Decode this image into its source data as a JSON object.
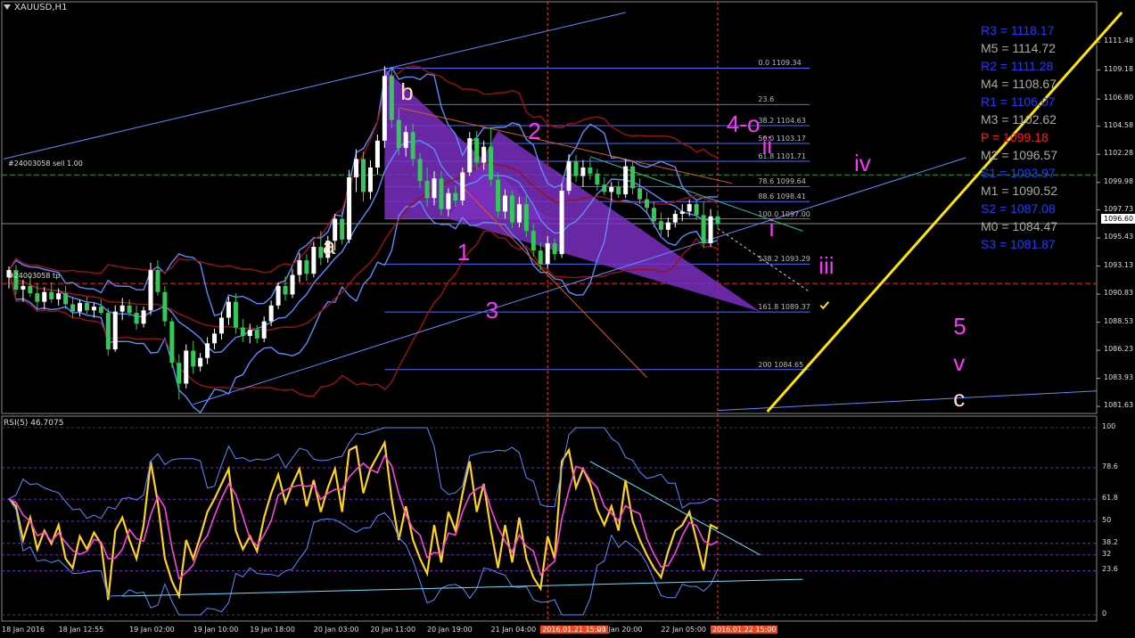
{
  "header": {
    "symbol": "XAUUSD,H1",
    "rsi_title": "RSI(5) 46.7075"
  },
  "colors": {
    "bg": "#000000",
    "bull": "#ffffff",
    "bear": "#34c759",
    "band_blue": "#5b8cff",
    "band_red": "#a01010",
    "pattern": "#7b2fbf",
    "yellow": "#ffe600",
    "magenta": "#ff33ff",
    "pivot_blue": "#1e3cff",
    "pivot_gray": "#aaaaaa",
    "pivot_red": "#ff1a1a"
  },
  "orders": {
    "sell_label": "#24003058 sell 1.00",
    "tp_label": "#24003058 tp",
    "current_price": "1096.60"
  },
  "pivots": [
    {
      "label": "R3 = 1118.17",
      "color": "#1e3cff"
    },
    {
      "label": "M5 = 1114.72",
      "color": "#aaaaaa"
    },
    {
      "label": "R2 = 1111.28",
      "color": "#1e3cff"
    },
    {
      "label": "M4 = 1108.67",
      "color": "#aaaaaa"
    },
    {
      "label": "R1 = 1106.07",
      "color": "#1e3cff"
    },
    {
      "label": "M3 = 1102.62",
      "color": "#aaaaaa"
    },
    {
      "label": "P = 1099.18",
      "color": "#ff1a1a"
    },
    {
      "label": "M2 = 1096.57",
      "color": "#aaaaaa"
    },
    {
      "label": "S1 = 1093.97",
      "color": "#1e3cff"
    },
    {
      "label": "M1 = 1090.52",
      "color": "#aaaaaa"
    },
    {
      "label": "S2 = 1087.08",
      "color": "#1e3cff"
    },
    {
      "label": "M0 = 1084.47",
      "color": "#aaaaaa"
    },
    {
      "label": "S3 = 1081.87",
      "color": "#1e3cff"
    }
  ],
  "fib_levels": [
    {
      "label": "0.0 1109.34",
      "price": 1109.34
    },
    {
      "label": "23.6",
      "price": 1106.35
    },
    {
      "label": "38.2 1104.63",
      "price": 1104.63
    },
    {
      "label": "50.0 1103.17",
      "price": 1103.17
    },
    {
      "label": "61.8 1101.71",
      "price": 1101.71
    },
    {
      "label": "78.6 1099.64",
      "price": 1099.64
    },
    {
      "label": "88.6 1098.41",
      "price": 1098.41
    },
    {
      "label": "100.0 1097.00",
      "price": 1097.0
    },
    {
      "label": "138.2 1093.29",
      "price": 1093.29
    },
    {
      "label": "161.8 1089.37",
      "price": 1089.37
    },
    {
      "label": "200 1084.65",
      "price": 1084.65
    }
  ],
  "waves": [
    {
      "text": "b",
      "color": "#ffe0c0",
      "x": 56,
      "y": 1107.4
    },
    {
      "text": "2",
      "color": "#ff33ff",
      "x": 74,
      "y": 1104.2
    },
    {
      "text": "4-o",
      "color": "#ff33ff",
      "x": 102,
      "y": 1104.8
    },
    {
      "text": "ii",
      "color": "#ff33ff",
      "x": 107,
      "y": 1103.0
    },
    {
      "text": "iv",
      "color": "#ff33ff",
      "x": 120,
      "y": 1101.6
    },
    {
      "text": "a",
      "color": "#ffe0c0",
      "x": 45,
      "y": 1094.8
    },
    {
      "text": "1",
      "color": "#ff33ff",
      "x": 64,
      "y": 1094.3
    },
    {
      "text": "i",
      "color": "#ff33ff",
      "x": 108,
      "y": 1096.2
    },
    {
      "text": "iii",
      "color": "#ff33ff",
      "x": 115,
      "y": 1093.2
    },
    {
      "text": "3",
      "color": "#ff33ff",
      "x": 68,
      "y": 1089.5
    },
    {
      "text": "5",
      "color": "#ff33ff",
      "x": 134,
      "y": 1088.2
    },
    {
      "text": "v",
      "color": "#ff33ff",
      "x": 134,
      "y": 1085.2
    },
    {
      "text": "c",
      "color": "#ffe0c0",
      "x": 134,
      "y": 1082.3
    }
  ],
  "chart_data": {
    "type": "candlestick",
    "symbol": "XAUUSD",
    "timeframe": "H1",
    "x_ticks": [
      {
        "label": "18 Jan 2016",
        "bar": 0
      },
      {
        "label": "18 Jan 12:55",
        "bar": 8
      },
      {
        "label": "19 Jan 02:00",
        "bar": 18
      },
      {
        "label": "19 Jan 10:00",
        "bar": 27
      },
      {
        "label": "19 Jan 18:00",
        "bar": 35
      },
      {
        "label": "20 Jan 03:00",
        "bar": 44
      },
      {
        "label": "20 Jan 11:00",
        "bar": 52
      },
      {
        "label": "20 Jan 19:00",
        "bar": 60
      },
      {
        "label": "21 Jan 04:00",
        "bar": 69
      },
      {
        "label": "2016.01.21 15:00",
        "bar": 76,
        "highlight": true
      },
      {
        "label": "21 Jan 20:00",
        "bar": 84
      },
      {
        "label": "22 Jan 05:00",
        "bar": 93
      },
      {
        "label": "2016.01.22 15:00",
        "bar": 100,
        "highlight": true
      }
    ],
    "y_ticks": [
      "1111.48",
      "1109.18",
      "1106.80",
      "1104.58",
      "1102.28",
      "1099.98",
      "1097.73",
      "1095.43",
      "1093.13",
      "1090.83",
      "1088.53",
      "1086.23",
      "1083.93",
      "1081.63"
    ],
    "ylim": [
      1081.2,
      1113.9
    ],
    "rsi_ticks": [
      "100",
      "78.6",
      "61.8",
      "50",
      "38.2",
      "32",
      "23.6",
      "0"
    ],
    "rsi_levels": [
      100,
      78.6,
      61.8,
      50,
      38.2,
      32,
      23.6,
      0
    ],
    "levels": {
      "sell_entry": 1100.6,
      "take_profit": 1091.7,
      "current": 1096.6
    },
    "candles": [
      [
        1092.2,
        1093.1,
        1091.3,
        1092.8
      ],
      [
        1092.8,
        1093.2,
        1090.8,
        1091.2
      ],
      [
        1091.2,
        1092.0,
        1090.2,
        1091.5
      ],
      [
        1091.5,
        1092.3,
        1090.6,
        1090.9
      ],
      [
        1090.9,
        1091.7,
        1089.5,
        1090.2
      ],
      [
        1090.2,
        1091.4,
        1089.6,
        1091.0
      ],
      [
        1091.0,
        1091.8,
        1090.1,
        1090.4
      ],
      [
        1090.4,
        1091.3,
        1089.9,
        1090.9
      ],
      [
        1090.9,
        1091.5,
        1089.6,
        1090.0
      ],
      [
        1090.0,
        1090.6,
        1088.9,
        1089.4
      ],
      [
        1089.4,
        1090.4,
        1089.0,
        1090.1
      ],
      [
        1090.1,
        1090.6,
        1089.2,
        1089.5
      ],
      [
        1089.5,
        1090.1,
        1088.9,
        1089.8
      ],
      [
        1089.8,
        1090.4,
        1089.1,
        1089.3
      ],
      [
        1089.3,
        1089.7,
        1085.8,
        1086.3
      ],
      [
        1086.3,
        1089.9,
        1086.1,
        1089.4
      ],
      [
        1089.4,
        1090.5,
        1088.7,
        1089.9
      ],
      [
        1089.9,
        1090.4,
        1089.0,
        1089.3
      ],
      [
        1089.3,
        1089.9,
        1087.9,
        1088.4
      ],
      [
        1088.4,
        1089.8,
        1088.1,
        1089.5
      ],
      [
        1089.5,
        1093.4,
        1089.1,
        1092.8
      ],
      [
        1092.8,
        1093.6,
        1090.7,
        1091.0
      ],
      [
        1091.0,
        1091.5,
        1088.2,
        1088.6
      ],
      [
        1088.6,
        1088.9,
        1084.8,
        1085.2
      ],
      [
        1085.2,
        1085.9,
        1082.2,
        1083.5
      ],
      [
        1083.5,
        1086.7,
        1083.1,
        1086.2
      ],
      [
        1086.2,
        1087.0,
        1084.3,
        1084.9
      ],
      [
        1084.9,
        1086.0,
        1084.5,
        1085.6
      ],
      [
        1085.6,
        1087.3,
        1085.1,
        1086.8
      ],
      [
        1086.8,
        1088.0,
        1086.3,
        1087.6
      ],
      [
        1087.6,
        1089.4,
        1087.1,
        1088.9
      ],
      [
        1088.9,
        1090.6,
        1088.3,
        1090.2
      ],
      [
        1090.2,
        1090.9,
        1087.6,
        1088.1
      ],
      [
        1088.1,
        1088.8,
        1086.9,
        1087.4
      ],
      [
        1087.4,
        1088.4,
        1086.8,
        1087.9
      ],
      [
        1087.9,
        1088.3,
        1086.8,
        1087.2
      ],
      [
        1087.2,
        1089.0,
        1086.9,
        1088.6
      ],
      [
        1088.6,
        1090.3,
        1088.2,
        1089.9
      ],
      [
        1089.9,
        1091.8,
        1089.6,
        1091.5
      ],
      [
        1091.5,
        1092.3,
        1090.3,
        1090.8
      ],
      [
        1090.8,
        1092.9,
        1090.5,
        1092.4
      ],
      [
        1092.4,
        1094.2,
        1091.8,
        1093.6
      ],
      [
        1093.6,
        1094.1,
        1091.9,
        1092.5
      ],
      [
        1092.5,
        1095.1,
        1092.2,
        1094.7
      ],
      [
        1094.7,
        1096.0,
        1093.2,
        1093.8
      ],
      [
        1093.8,
        1095.6,
        1093.4,
        1095.2
      ],
      [
        1095.2,
        1097.4,
        1094.4,
        1097.0
      ],
      [
        1097.0,
        1097.6,
        1094.9,
        1095.3
      ],
      [
        1095.3,
        1101.0,
        1095.0,
        1100.4
      ],
      [
        1100.4,
        1102.7,
        1099.2,
        1101.9
      ],
      [
        1101.9,
        1102.5,
        1098.4,
        1099.2
      ],
      [
        1099.2,
        1101.8,
        1098.6,
        1101.2
      ],
      [
        1101.2,
        1103.9,
        1100.6,
        1103.4
      ],
      [
        1103.4,
        1109.5,
        1102.8,
        1108.7
      ],
      [
        1108.7,
        1109.3,
        1104.4,
        1105.1
      ],
      [
        1105.1,
        1106.0,
        1102.2,
        1102.8
      ],
      [
        1102.8,
        1104.6,
        1102.1,
        1104.1
      ],
      [
        1104.1,
        1104.8,
        1101.3,
        1101.9
      ],
      [
        1101.9,
        1102.4,
        1099.5,
        1100.1
      ],
      [
        1100.1,
        1101.2,
        1098.0,
        1098.7
      ],
      [
        1098.7,
        1100.9,
        1098.1,
        1100.3
      ],
      [
        1100.3,
        1100.9,
        1097.3,
        1097.8
      ],
      [
        1097.8,
        1099.5,
        1097.2,
        1099.1
      ],
      [
        1099.1,
        1099.7,
        1098.0,
        1098.5
      ],
      [
        1098.5,
        1101.2,
        1098.1,
        1100.8
      ],
      [
        1100.8,
        1104.1,
        1100.5,
        1103.6
      ],
      [
        1103.6,
        1104.2,
        1101.1,
        1101.6
      ],
      [
        1101.6,
        1103.4,
        1101.0,
        1102.9
      ],
      [
        1102.9,
        1104.5,
        1099.7,
        1100.2
      ],
      [
        1100.2,
        1100.8,
        1097.1,
        1097.6
      ],
      [
        1097.6,
        1099.4,
        1097.0,
        1098.9
      ],
      [
        1098.9,
        1099.3,
        1096.2,
        1096.7
      ],
      [
        1096.7,
        1098.8,
        1096.3,
        1098.2
      ],
      [
        1098.2,
        1098.9,
        1095.5,
        1096.0
      ],
      [
        1096.0,
        1096.6,
        1093.9,
        1094.4
      ],
      [
        1094.4,
        1095.1,
        1092.8,
        1093.3
      ],
      [
        1093.3,
        1095.6,
        1092.9,
        1095.0
      ],
      [
        1095.0,
        1095.4,
        1093.6,
        1094.1
      ],
      [
        1094.1,
        1099.9,
        1093.8,
        1099.3
      ],
      [
        1099.3,
        1102.3,
        1099.0,
        1101.7
      ],
      [
        1101.7,
        1102.2,
        1100.0,
        1100.5
      ],
      [
        1100.5,
        1101.8,
        1099.6,
        1101.2
      ],
      [
        1101.2,
        1102.0,
        1100.2,
        1100.7
      ],
      [
        1100.7,
        1101.1,
        1099.3,
        1099.8
      ],
      [
        1099.8,
        1100.4,
        1098.9,
        1099.2
      ],
      [
        1099.2,
        1100.0,
        1098.5,
        1099.6
      ],
      [
        1099.6,
        1100.1,
        1098.7,
        1099.0
      ],
      [
        1099.0,
        1101.9,
        1098.7,
        1101.3
      ],
      [
        1101.3,
        1101.7,
        1099.0,
        1099.5
      ],
      [
        1099.5,
        1100.3,
        1098.2,
        1098.6
      ],
      [
        1098.6,
        1099.2,
        1097.4,
        1097.9
      ],
      [
        1097.9,
        1098.4,
        1096.3,
        1096.8
      ],
      [
        1096.8,
        1097.5,
        1095.6,
        1096.1
      ],
      [
        1096.1,
        1097.1,
        1095.5,
        1096.7
      ],
      [
        1096.7,
        1097.7,
        1096.3,
        1097.4
      ],
      [
        1097.4,
        1098.2,
        1096.8,
        1097.6
      ],
      [
        1097.6,
        1098.6,
        1097.2,
        1098.2
      ],
      [
        1098.2,
        1098.5,
        1096.9,
        1097.3
      ],
      [
        1097.3,
        1098.4,
        1094.6,
        1095.0
      ],
      [
        1095.0,
        1097.8,
        1094.7,
        1097.2
      ],
      [
        1097.2,
        1097.7,
        1096.3,
        1096.6
      ]
    ],
    "rsi_series": [
      {
        "name": "RSI(5)",
        "values": [
          62,
          58,
          40,
          52,
          35,
          45,
          38,
          48,
          30,
          25,
          42,
          35,
          44,
          38,
          8,
          45,
          52,
          40,
          30,
          48,
          82,
          60,
          30,
          18,
          10,
          40,
          30,
          42,
          55,
          62,
          70,
          78,
          45,
          35,
          42,
          34,
          52,
          65,
          75,
          60,
          70,
          78,
          58,
          72,
          55,
          68,
          78,
          55,
          88,
          90,
          65,
          78,
          85,
          92,
          62,
          40,
          58,
          40,
          30,
          22,
          48,
          28,
          55,
          45,
          65,
          82,
          55,
          70,
          45,
          25,
          48,
          28,
          52,
          30,
          20,
          14,
          42,
          30,
          82,
          88,
          68,
          78,
          70,
          56,
          48,
          58,
          45,
          72,
          50,
          40,
          32,
          25,
          20,
          34,
          45,
          48,
          55,
          40,
          24,
          48,
          46
        ]
      }
    ]
  }
}
